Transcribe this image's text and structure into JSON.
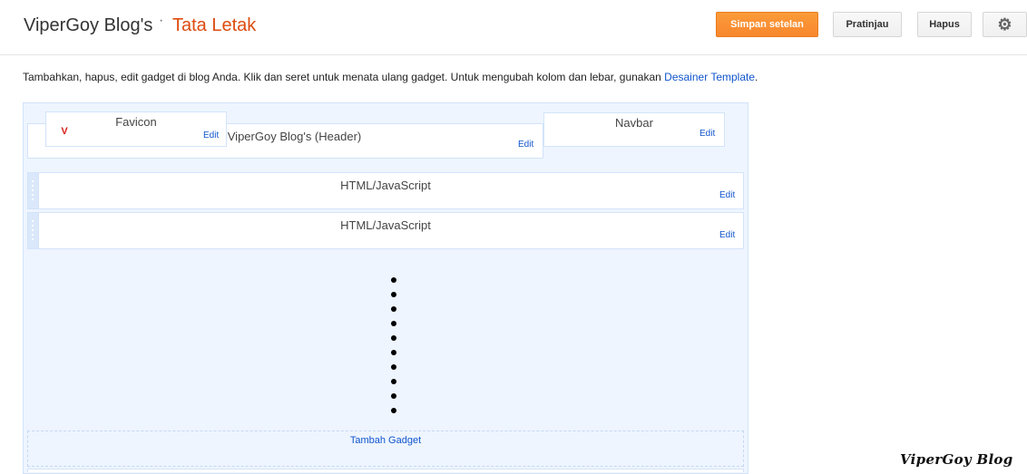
{
  "header": {
    "blog_title": "ViperGoy Blog's",
    "separator": "·",
    "section_title": "Tata Letak"
  },
  "toolbar": {
    "save_label": "Simpan setelan",
    "preview_label": "Pratinjau",
    "delete_label": "Hapus",
    "settings_icon": "gear-icon"
  },
  "intro": {
    "text": "Tambahkan, hapus, edit gadget di blog Anda. Klik dan seret untuk menata ulang gadget. Untuk mengubah kolom dan lebar, gunakan ",
    "link_text": "Desainer Template",
    "suffix": "."
  },
  "gadgets": {
    "favicon": {
      "name": "Favicon",
      "edit": "Edit",
      "icon_glyph": "V"
    },
    "header": {
      "name": "ViperGoy Blog's (Header)",
      "edit": "Edit"
    },
    "navbar": {
      "name": "Navbar",
      "edit": "Edit"
    },
    "html1": {
      "name": "HTML/JavaScript",
      "edit": "Edit"
    },
    "html2": {
      "name": "HTML/JavaScript",
      "edit": "Edit"
    }
  },
  "add_gadget": "Tambah Gadget",
  "watermark": "ViperGoy Blog",
  "colors": {
    "accent_orange": "#f8872d",
    "title_orange": "#dd4b0f",
    "link_blue": "#1155cc",
    "layout_bg": "#eef5ff"
  }
}
